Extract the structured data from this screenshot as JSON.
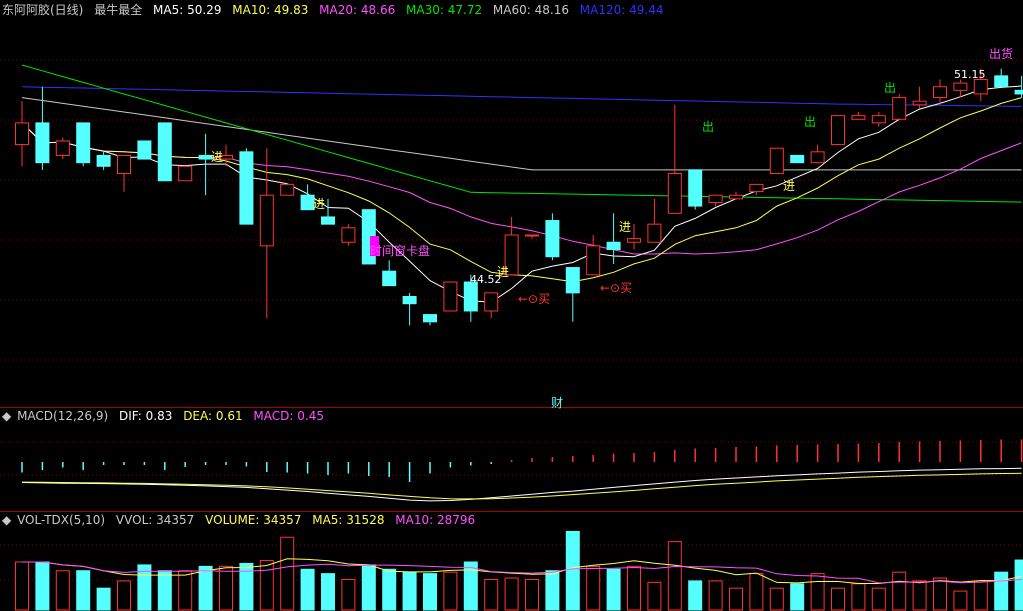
{
  "main_header": {
    "stock": "东阿阿胶(日线)",
    "indicator": "最牛最全",
    "ma5": "MA5: 50.29",
    "ma10": "MA10: 49.83",
    "ma20": "MA20: 48.66",
    "ma30": "MA30: 47.72",
    "ma60": "MA60: 48.16",
    "ma120": "MA120: 49.44"
  },
  "macd_header": {
    "name": "MACD(12,26,9)",
    "dif": "DIF: 0.83",
    "dea": "DEA: 0.61",
    "macd": "MACD: 0.45"
  },
  "vol_header": {
    "name": "VOL-TDX(5,10)",
    "vvol": "VVOL: 34357",
    "volume": "VOLUME: 34357",
    "ma5": "MA5: 31528",
    "ma10": "MA10: 28796"
  },
  "annotations": {
    "high_label": "51.15",
    "low_label": "44.52",
    "sell_top": "出货",
    "timing": "时间窗卡盘",
    "fin": "财",
    "in": "进",
    "out": "出",
    "buy": "买"
  },
  "colors": {
    "up": "#ff3232",
    "down": "#54ffff",
    "ma5": "#ffffff",
    "ma10": "#ffff50",
    "ma20": "#ff50ff",
    "ma30": "#00e600",
    "ma60": "#c8c8c8",
    "ma120": "#3030ff"
  },
  "chart_data": {
    "type": "candlestick",
    "price_range": [
      41.8,
      52.5
    ],
    "candles": [
      [
        49.0,
        49.6,
        48.4,
        50.2
      ],
      [
        49.6,
        48.5,
        48.3,
        50.6
      ],
      [
        48.7,
        49.1,
        48.6,
        49.2
      ],
      [
        49.6,
        48.5,
        48.4,
        49.6
      ],
      [
        48.7,
        48.4,
        48.3,
        48.8
      ],
      [
        48.2,
        48.7,
        47.7,
        48.7
      ],
      [
        49.1,
        48.6,
        48.6,
        49.1
      ],
      [
        49.6,
        48.0,
        48.0,
        49.6
      ],
      [
        48.0,
        48.4,
        48.0,
        48.4
      ],
      [
        48.7,
        48.6,
        47.6,
        49.3
      ],
      [
        48.6,
        48.7,
        48.4,
        49.0
      ],
      [
        48.8,
        46.8,
        46.8,
        48.9
      ],
      [
        46.2,
        47.6,
        44.2,
        48.9
      ],
      [
        47.6,
        47.9,
        47.6,
        47.9
      ],
      [
        47.6,
        47.2,
        47.2,
        47.9
      ],
      [
        47.0,
        46.8,
        46.8,
        47.5
      ],
      [
        46.3,
        46.7,
        46.2,
        46.8
      ],
      [
        47.2,
        45.7,
        45.7,
        47.2
      ],
      [
        45.5,
        45.1,
        45.1,
        45.8
      ],
      [
        44.8,
        44.6,
        44.0,
        44.9
      ],
      [
        44.3,
        44.1,
        44.0,
        44.3
      ],
      [
        44.4,
        45.2,
        44.4,
        45.2
      ],
      [
        45.2,
        44.4,
        44.1,
        45.4
      ],
      [
        44.4,
        44.9,
        44.2,
        44.9
      ],
      [
        45.4,
        46.5,
        45.4,
        47.0
      ],
      [
        46.5,
        46.5,
        46.4,
        46.5
      ],
      [
        46.9,
        45.9,
        45.8,
        47.1
      ],
      [
        45.6,
        44.9,
        44.1,
        45.6
      ],
      [
        45.4,
        46.2,
        45.4,
        46.5
      ],
      [
        46.3,
        46.1,
        45.7,
        47.1
      ],
      [
        46.3,
        46.4,
        46.1,
        46.8
      ],
      [
        46.3,
        46.8,
        46.3,
        47.5
      ],
      [
        47.1,
        48.2,
        47.1,
        50.1
      ],
      [
        48.3,
        47.3,
        47.2,
        48.3
      ],
      [
        47.4,
        47.6,
        47.3,
        47.6
      ],
      [
        47.5,
        47.6,
        47.5,
        47.7
      ],
      [
        47.7,
        47.9,
        47.6,
        47.9
      ],
      [
        48.2,
        48.9,
        48.2,
        48.9
      ],
      [
        48.7,
        48.5,
        48.5,
        48.7
      ],
      [
        48.5,
        48.8,
        48.5,
        49.0
      ],
      [
        49.0,
        49.8,
        49.0,
        49.8
      ],
      [
        49.7,
        49.8,
        49.7,
        49.9
      ],
      [
        49.6,
        49.8,
        49.5,
        49.9
      ],
      [
        49.7,
        50.3,
        49.7,
        50.4
      ],
      [
        50.1,
        50.2,
        50.0,
        50.6
      ],
      [
        50.3,
        50.6,
        50.1,
        50.8
      ],
      [
        50.5,
        50.7,
        50.3,
        50.8
      ],
      [
        50.4,
        50.8,
        50.2,
        51.1
      ],
      [
        50.9,
        50.6,
        50.6,
        51.1
      ],
      [
        50.5,
        50.4,
        50.3,
        50.9
      ]
    ],
    "macd": [
      -0.21,
      -0.16,
      -0.11,
      -0.16,
      -0.06,
      -0.06,
      -0.06,
      -0.16,
      -0.1,
      -0.06,
      -0.06,
      -0.09,
      -0.2,
      -0.21,
      -0.23,
      -0.26,
      -0.23,
      -0.28,
      -0.3,
      -0.4,
      -0.23,
      -0.11,
      -0.07,
      -0.04,
      0.04,
      0.08,
      0.1,
      0.12,
      0.14,
      0.17,
      0.18,
      0.2,
      0.24,
      0.27,
      0.28,
      0.3,
      0.31,
      0.33,
      0.34,
      0.35,
      0.36,
      0.37,
      0.38,
      0.4,
      0.41,
      0.42,
      0.43,
      0.44,
      0.45,
      0.45
    ],
    "dif": [
      0.2,
      0.18,
      0.17,
      0.16,
      0.15,
      0.14,
      0.12,
      0.1,
      0.08,
      0.05,
      0.02,
      -0.02,
      -0.08,
      -0.14,
      -0.2,
      -0.28,
      -0.35,
      -0.42,
      -0.5,
      -0.58,
      -0.62,
      -0.6,
      -0.55,
      -0.48,
      -0.4,
      -0.32,
      -0.24,
      -0.18,
      -0.1,
      -0.02,
      0.06,
      0.14,
      0.22,
      0.29,
      0.35,
      0.4,
      0.45,
      0.5,
      0.54,
      0.58,
      0.62,
      0.66,
      0.69,
      0.72,
      0.75,
      0.77,
      0.79,
      0.81,
      0.82,
      0.83
    ],
    "dea": [
      0.22,
      0.21,
      0.2,
      0.19,
      0.18,
      0.17,
      0.16,
      0.14,
      0.12,
      0.1,
      0.08,
      0.05,
      0.01,
      -0.04,
      -0.1,
      -0.16,
      -0.22,
      -0.28,
      -0.35,
      -0.42,
      -0.48,
      -0.52,
      -0.53,
      -0.52,
      -0.49,
      -0.45,
      -0.4,
      -0.34,
      -0.28,
      -0.22,
      -0.15,
      -0.08,
      -0.01,
      0.06,
      0.12,
      0.17,
      0.22,
      0.27,
      0.31,
      0.35,
      0.39,
      0.43,
      0.46,
      0.49,
      0.52,
      0.54,
      0.56,
      0.58,
      0.6,
      0.61
    ],
    "volume": [
      33000,
      33000,
      27000,
      27000,
      15000,
      20000,
      31000,
      27000,
      27000,
      30000,
      30000,
      32000,
      34000,
      50000,
      28000,
      25000,
      21000,
      31000,
      28000,
      26000,
      25000,
      26000,
      33000,
      21000,
      22000,
      21000,
      27000,
      54000,
      30000,
      28000,
      30000,
      19000,
      47000,
      20000,
      20000,
      15000,
      25000,
      15000,
      18000,
      25000,
      15000,
      18000,
      15000,
      26000,
      20000,
      22000,
      13000,
      20000,
      26000,
      34357
    ],
    "ma_values": {
      "ma5": 50.29,
      "ma10": 49.83,
      "ma20": 48.66,
      "ma30": 47.72,
      "ma60": 48.16,
      "ma120": 49.44
    }
  }
}
